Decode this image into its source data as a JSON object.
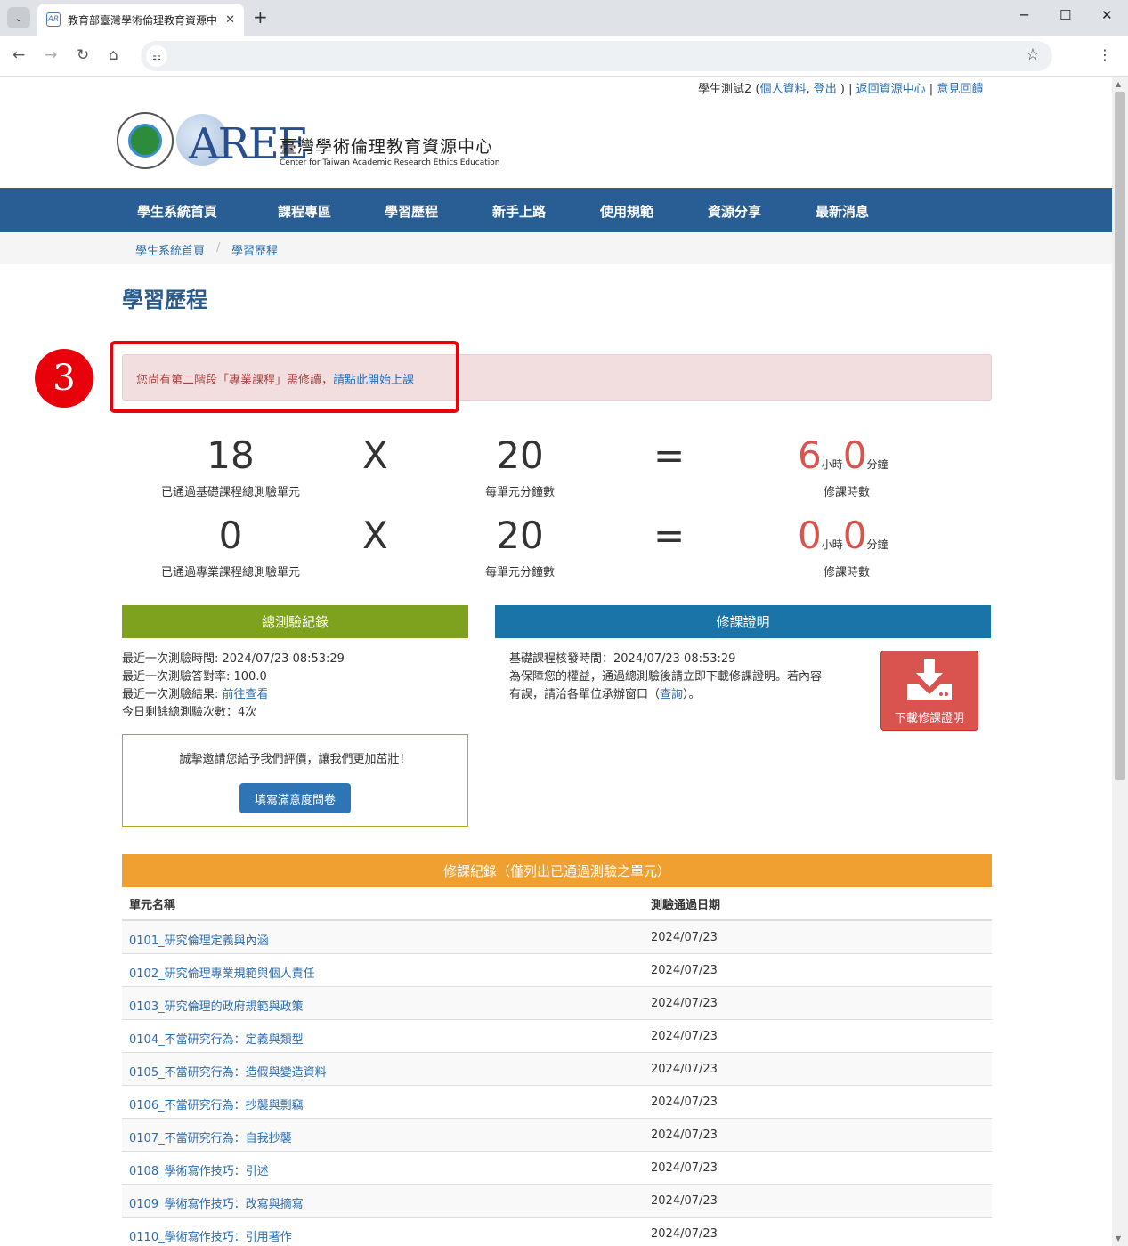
{
  "browser": {
    "tab_title": "教育部臺灣學術倫理教育資源中",
    "tab_favicon": "AR",
    "new_tab": "+",
    "minimize": "─",
    "maximize": "☐",
    "close": "✕"
  },
  "topinfo": {
    "user": "學生測試2 (",
    "profile": "個人資料",
    "comma": ", ",
    "logout": "登出",
    "close_paren": " ) | ",
    "back": "返回資源中心",
    "sep": " | ",
    "feedback": "意見回饋"
  },
  "logo": {
    "mark": "AREE",
    "title": "臺灣學術倫理教育資源中心",
    "subtitle": "Center for Taiwan Academic Research Ethics Education"
  },
  "nav": {
    "items": [
      "學生系統首頁",
      "課程專區",
      "學習歷程",
      "新手上路",
      "使用規範",
      "資源分享",
      "最新消息"
    ]
  },
  "breadcrumb": {
    "home": "學生系統首頁",
    "sep": "/",
    "current": "學習歷程"
  },
  "page_title": "學習歷程",
  "step_badge": "3",
  "alert": {
    "text": "您尚有第二階段「專業課程」需修讀，",
    "link": "請點此開始上課"
  },
  "stats": {
    "row1": {
      "units": "18",
      "units_caption": "已通過基礎課程總測驗單元",
      "times": "X",
      "minutes": "20",
      "minutes_caption": "每單元分鐘數",
      "equals": "=",
      "hours": "6",
      "hours_unit": "小時",
      "mins": "0",
      "mins_unit": "分鐘",
      "total_caption": "修課時數"
    },
    "row2": {
      "units": "0",
      "units_caption": "已通過專業課程總測驗單元",
      "times": "X",
      "minutes": "20",
      "minutes_caption": "每單元分鐘數",
      "equals": "=",
      "hours": "0",
      "hours_unit": "小時",
      "mins": "0",
      "mins_unit": "分鐘",
      "total_caption": "修課時數"
    }
  },
  "exam_panel": {
    "title": "總測驗紀錄",
    "color": "#7fa21e",
    "last_time": "最近一次測驗時間: 2024/07/23 08:53:29",
    "last_rate": "最近一次測驗答對率: 100.0",
    "last_result_label": "最近一次測驗結果: ",
    "last_result_link": "前往查看",
    "remaining": "今日剩餘總測驗次數：4次"
  },
  "survey": {
    "text": "誠摯邀請您給予我們評價，讓我們更加茁壯！",
    "button": "填寫滿意度問卷"
  },
  "cert_panel": {
    "title": "修課證明",
    "color": "#1b74a8",
    "issued": "基礎課程核發時間：2024/07/23 08:53:29",
    "note1": "為保障您的權益，通過總測驗後請立即下載修課證明。若內容",
    "note2_a": "有誤，請洽各單位承辦窗口（",
    "note2_link": "查詢",
    "note2_b": "）。",
    "download": "下載修課證明"
  },
  "records": {
    "title": "修課紀錄（僅列出已通過測驗之單元）",
    "color": "#f0a030",
    "col_name": "單元名稱",
    "col_date": "測驗通過日期",
    "rows": [
      {
        "name": "0101_研究倫理定義與內涵",
        "date": "2024/07/23"
      },
      {
        "name": "0102_研究倫理專業規範與個人責任",
        "date": "2024/07/23"
      },
      {
        "name": "0103_研究倫理的政府規範與政策",
        "date": "2024/07/23"
      },
      {
        "name": "0104_不當研究行為：定義與類型",
        "date": "2024/07/23"
      },
      {
        "name": "0105_不當研究行為：造假與變造資料",
        "date": "2024/07/23"
      },
      {
        "name": "0106_不當研究行為：抄襲與剽竊",
        "date": "2024/07/23"
      },
      {
        "name": "0107_不當研究行為：自我抄襲",
        "date": "2024/07/23"
      },
      {
        "name": "0108_學術寫作技巧：引述",
        "date": "2024/07/23"
      },
      {
        "name": "0109_學術寫作技巧：改寫與摘寫",
        "date": "2024/07/23"
      },
      {
        "name": "0110_學術寫作技巧：引用著作",
        "date": "2024/07/23"
      }
    ]
  }
}
